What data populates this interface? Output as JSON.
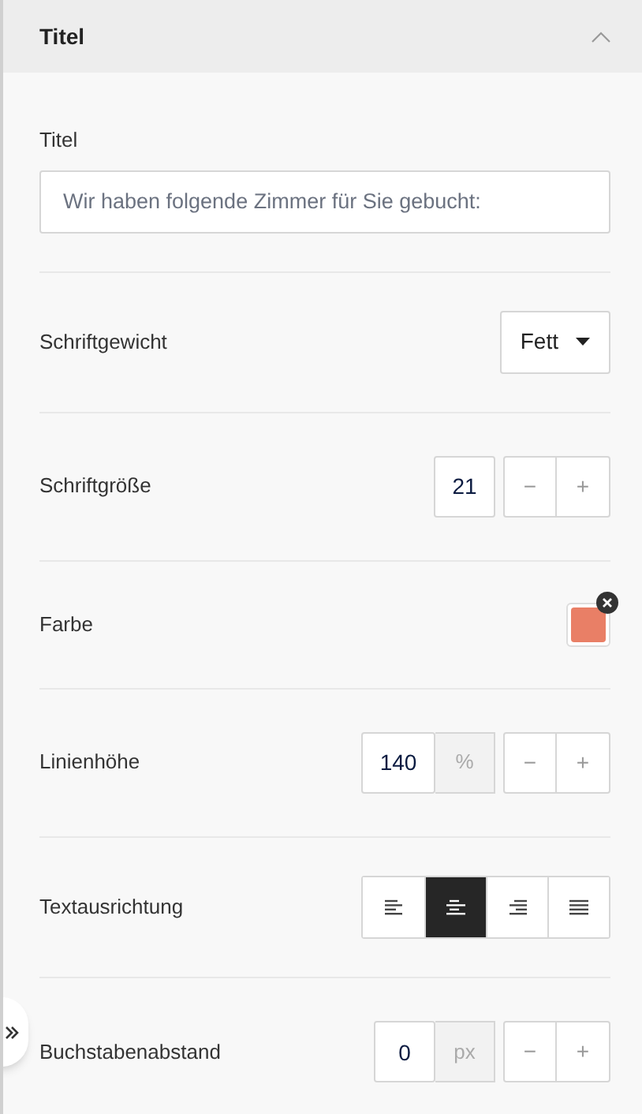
{
  "section": {
    "title": "Titel",
    "expanded": true
  },
  "fields": [
    {
      "kind": "text",
      "label": "Titel",
      "placeholder": "Wir haben folgende Zimmer für Sie gebucht:"
    },
    {
      "kind": "select",
      "label": "Schriftgewicht",
      "value": "Fett"
    },
    {
      "kind": "number",
      "label": "Schriftgröße",
      "value": "21",
      "decrement": "−",
      "increment": "+"
    },
    {
      "kind": "color",
      "label": "Farbe",
      "color": "#e97f66"
    },
    {
      "kind": "number",
      "label": "Linienhöhe",
      "value": "140",
      "unit": "%",
      "decrement": "−",
      "increment": "+"
    },
    {
      "kind": "align",
      "label": "Textausrichtung",
      "options": [
        {
          "kind": "left",
          "selected": false
        },
        {
          "kind": "center",
          "selected": true
        },
        {
          "kind": "right",
          "selected": false
        },
        {
          "kind": "justify",
          "selected": false
        }
      ]
    },
    {
      "kind": "number",
      "label": "Buchstabenabstand",
      "value": "0",
      "unit": "px",
      "decrement": "−",
      "increment": "+"
    }
  ]
}
